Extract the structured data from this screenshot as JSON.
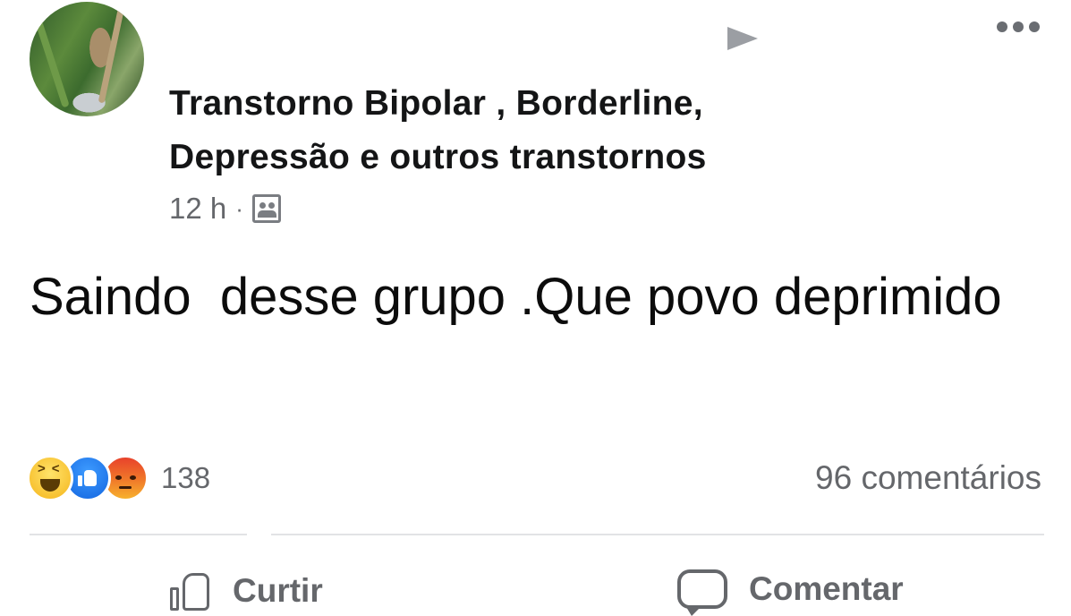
{
  "post": {
    "group_name": "Transtorno Bipolar , Borderline, Depressão e outros transtornos",
    "time": "12 h",
    "separator": "·",
    "privacy_icon": "group-icon",
    "text": "Saindo  desse grupo .Que povo deprimido"
  },
  "header_icons": {
    "play": "play-icon",
    "more": "more-icon"
  },
  "reactions": {
    "icons": [
      "haha-reaction-icon",
      "like-reaction-icon",
      "angry-reaction-icon"
    ],
    "count": "138",
    "comments": "96 comentários"
  },
  "actions": {
    "like_label": "Curtir",
    "comment_label": "Comentar"
  },
  "colors": {
    "secondary_text": "#65676b",
    "like_blue": "#1466e0",
    "haha_yellow": "#f5b51b",
    "angry_red": "#e8422b"
  }
}
